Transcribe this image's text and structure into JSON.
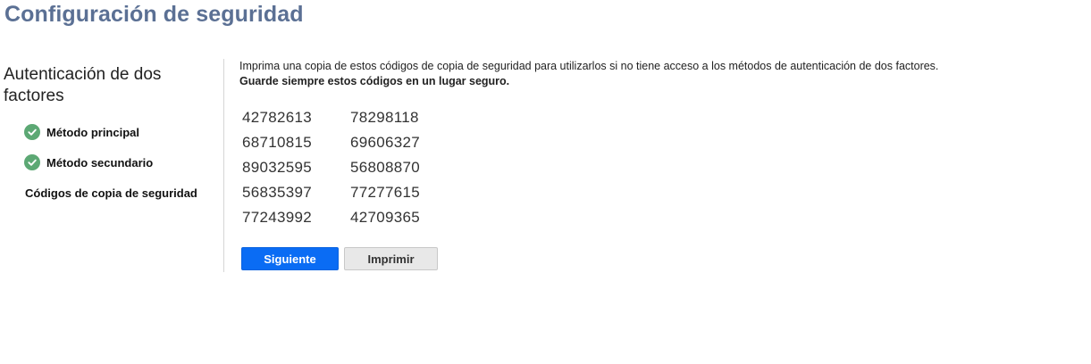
{
  "page": {
    "title": "Configuración de seguridad"
  },
  "sidebar": {
    "heading": "Autenticación de dos factores",
    "steps": [
      {
        "label": "Método principal",
        "status": "completed"
      },
      {
        "label": "Método secundario",
        "status": "completed"
      },
      {
        "label": "Códigos de copia de seguridad",
        "status": "current"
      }
    ]
  },
  "main": {
    "instructions": "Imprima una copia de estos códigos de copia de seguridad para utilizarlos si no tiene acceso a los métodos de autenticación de dos factores.",
    "warning": "Guarde siempre estos códigos en un lugar seguro.",
    "codes": [
      [
        "42782613",
        "78298118"
      ],
      [
        "68710815",
        "69606327"
      ],
      [
        "89032595",
        "56808870"
      ],
      [
        "56835397",
        "77277615"
      ],
      [
        "77243992",
        "42709365"
      ]
    ],
    "buttons": {
      "next_label": "Siguiente",
      "print_label": "Imprimir"
    }
  },
  "colors": {
    "title": "#5b7094",
    "check": "#5ca874",
    "primary_button": "#0a6cf4",
    "secondary_button": "#e8e8e8"
  },
  "icons": {
    "completed_step": "check-circle-icon"
  }
}
